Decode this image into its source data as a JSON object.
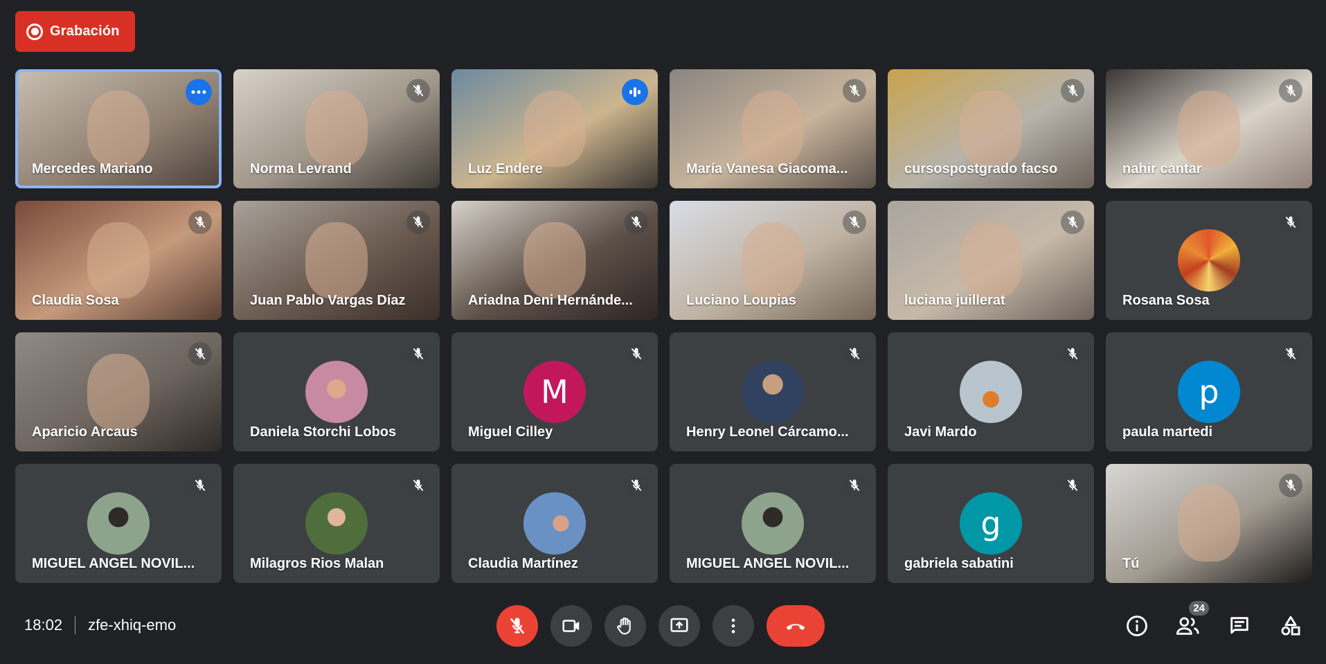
{
  "recording": {
    "label": "Grabación"
  },
  "participants": [
    {
      "name": "Mercedes Mariano",
      "kind": "video",
      "style": "v1",
      "status": "more",
      "active": true
    },
    {
      "name": "Norma Levrand",
      "kind": "video",
      "style": "v2",
      "status": "muted"
    },
    {
      "name": "Luz Endere",
      "kind": "video",
      "style": "v3",
      "status": "speaking"
    },
    {
      "name": "María Vanesa Giacoma...",
      "kind": "video",
      "style": "v4",
      "status": "muted"
    },
    {
      "name": "cursospostgrado facso",
      "kind": "video",
      "style": "v5",
      "status": "muted"
    },
    {
      "name": "nahir cantar",
      "kind": "video",
      "style": "v6",
      "status": "muted"
    },
    {
      "name": "Claudia Sosa",
      "kind": "video",
      "style": "v7",
      "status": "muted"
    },
    {
      "name": "Juan Pablo Vargas Díaz",
      "kind": "video",
      "style": "v8",
      "status": "muted"
    },
    {
      "name": "Ariadna Deni Hernánde...",
      "kind": "video",
      "style": "v9",
      "status": "muted"
    },
    {
      "name": "Luciano Loupias",
      "kind": "video",
      "style": "v10",
      "status": "muted"
    },
    {
      "name": "luciana juillerat",
      "kind": "video",
      "style": "v11",
      "status": "muted"
    },
    {
      "name": "Rosana Sosa",
      "kind": "avatar",
      "avatar": "mosaic",
      "status": "muted"
    },
    {
      "name": "Aparicio Arcaus",
      "kind": "video",
      "style": "v12",
      "status": "muted"
    },
    {
      "name": "Daniela Storchi Lobos",
      "kind": "avatar",
      "avatar": "hat",
      "status": "muted"
    },
    {
      "name": "Miguel Cilley",
      "kind": "avatar",
      "letter": "M",
      "color": "#c2185b",
      "status": "muted"
    },
    {
      "name": "Henry Leonel Cárcamo...",
      "kind": "avatar",
      "avatar": "suit",
      "status": "muted"
    },
    {
      "name": "Javi Mardo",
      "kind": "avatar",
      "avatar": "lake",
      "status": "muted"
    },
    {
      "name": "paula martedi",
      "kind": "avatar",
      "letter": "p",
      "color": "#0288d1",
      "status": "muted"
    },
    {
      "name": "MIGUEL ANGEL NOVIL...",
      "kind": "avatar",
      "avatar": "fish",
      "status": "muted"
    },
    {
      "name": "Milagros Rios Malan",
      "kind": "avatar",
      "avatar": "forest",
      "status": "muted"
    },
    {
      "name": "Claudia Martínez",
      "kind": "avatar",
      "avatar": "sky",
      "status": "muted"
    },
    {
      "name": "MIGUEL ANGEL NOVIL...",
      "kind": "avatar",
      "avatar": "fish",
      "status": "muted"
    },
    {
      "name": "gabriela sabatini",
      "kind": "avatar",
      "letter": "g",
      "color": "#0097a7",
      "status": "muted"
    },
    {
      "name": "Tú",
      "kind": "video",
      "style": "v13",
      "status": "muted"
    }
  ],
  "footer": {
    "time": "18:02",
    "meeting_code": "zfe-xhiq-emo",
    "participant_count": "24"
  },
  "colors": {
    "accent": "#8ab4f8",
    "danger": "#ea4335",
    "recording": "#d93025",
    "background": "#202124"
  }
}
